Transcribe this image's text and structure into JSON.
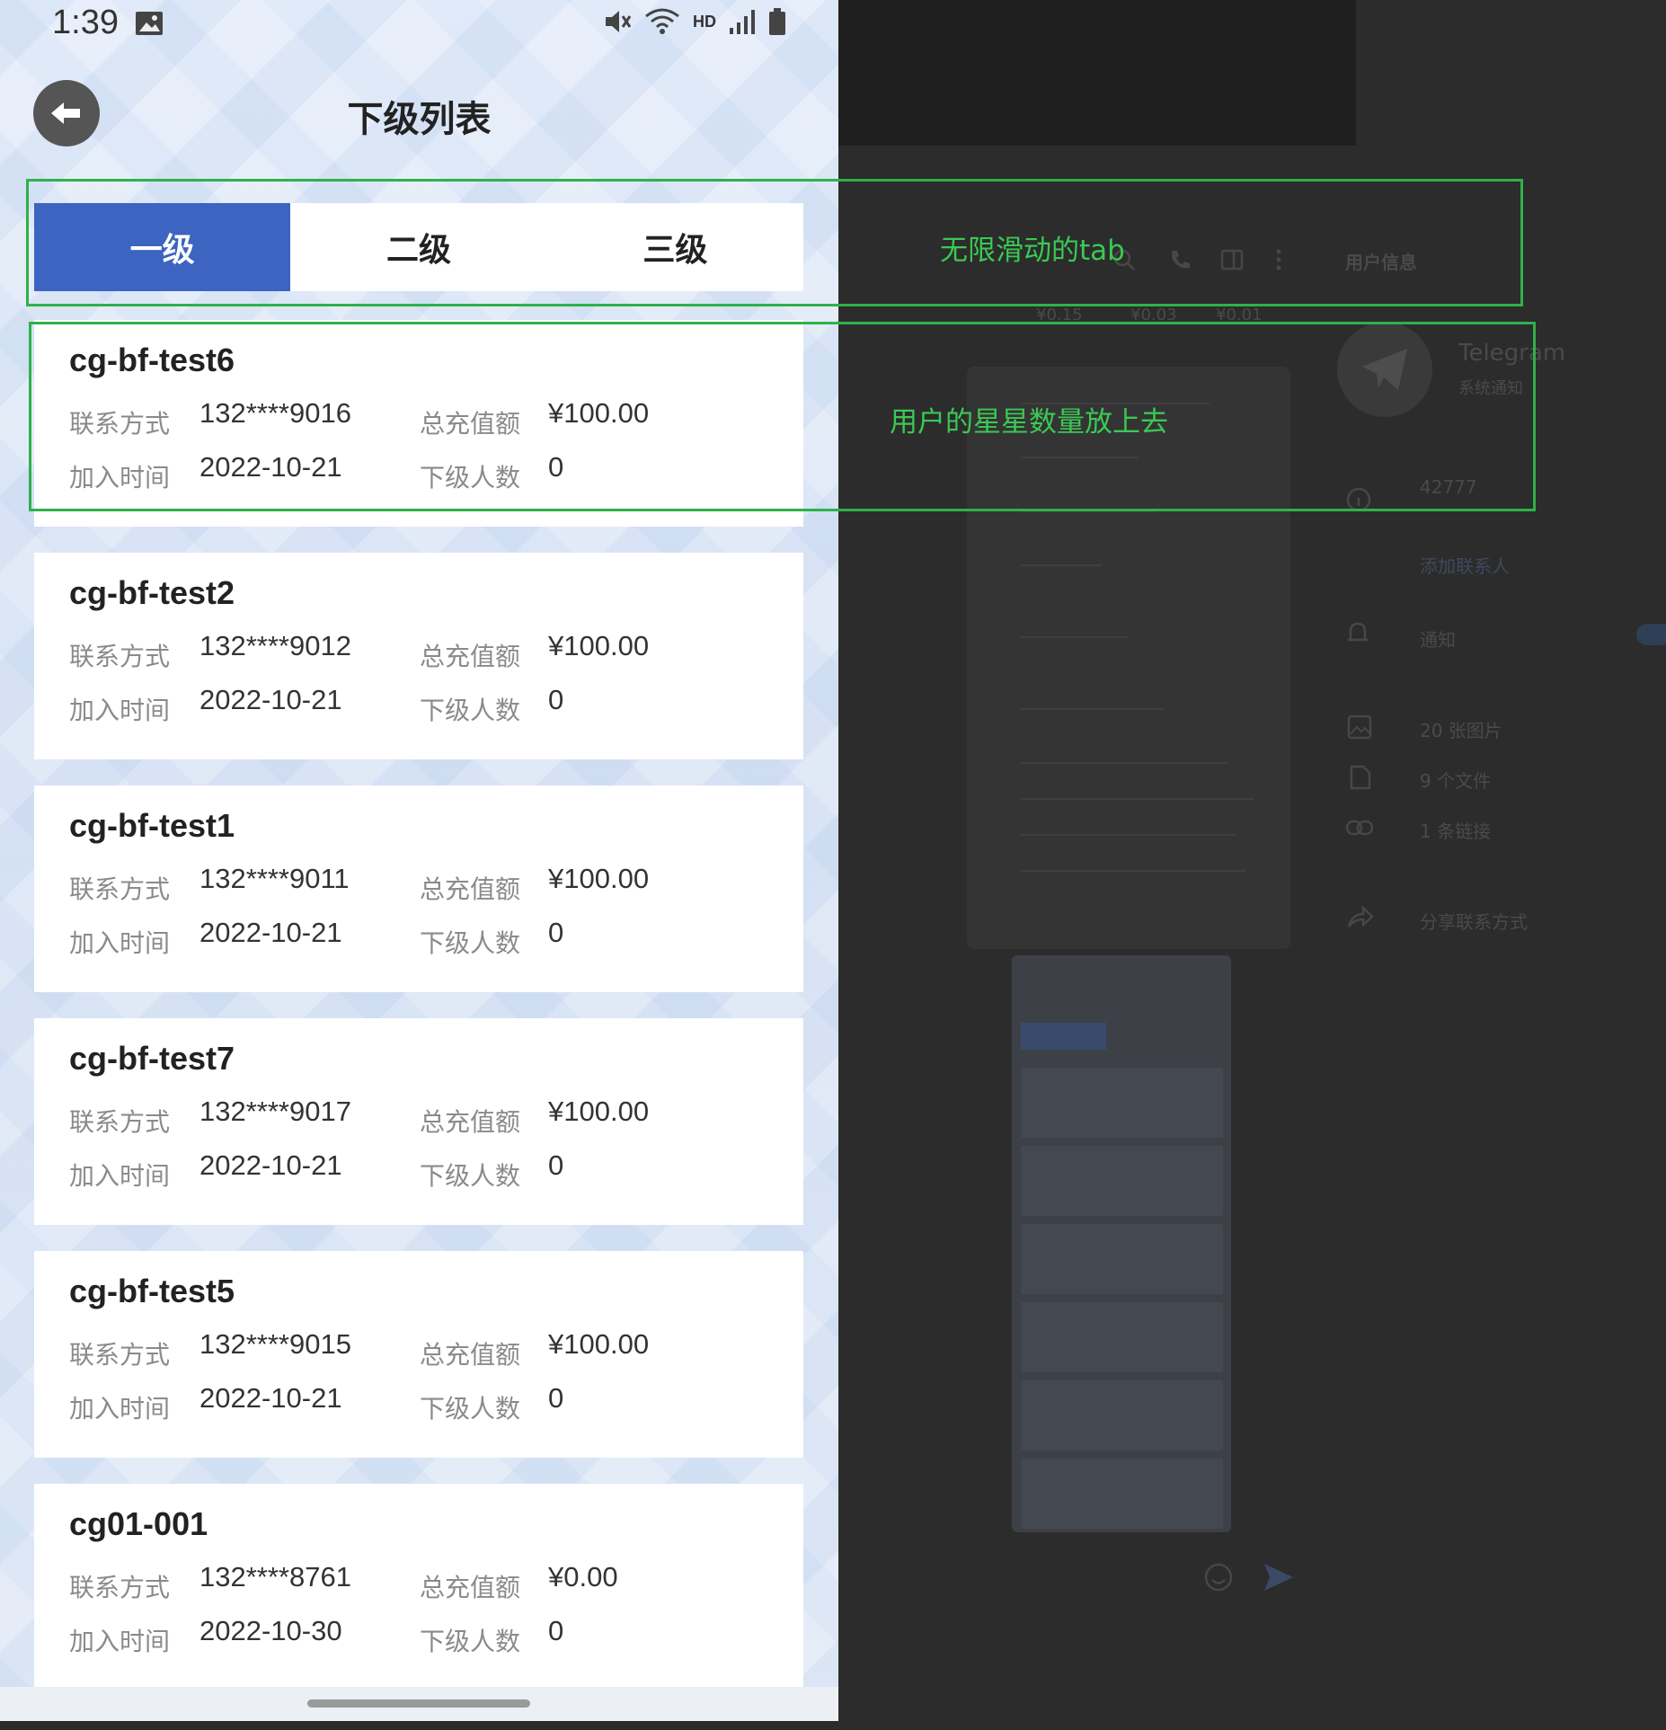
{
  "status_bar": {
    "time": "1:39",
    "network": "HD"
  },
  "header": {
    "title": "下级列表"
  },
  "tabs": [
    "一级",
    "二级",
    "三级"
  ],
  "labels": {
    "contact": "联系方式",
    "total_recharge": "总充值额",
    "join_time": "加入时间",
    "sub_count": "下级人数"
  },
  "members": [
    {
      "name": "cg-bf-test6",
      "contact": "132****9016",
      "total": "¥100.00",
      "joined": "2022-10-21",
      "subs": "0"
    },
    {
      "name": "cg-bf-test2",
      "contact": "132****9012",
      "total": "¥100.00",
      "joined": "2022-10-21",
      "subs": "0"
    },
    {
      "name": "cg-bf-test1",
      "contact": "132****9011",
      "total": "¥100.00",
      "joined": "2022-10-21",
      "subs": "0"
    },
    {
      "name": "cg-bf-test7",
      "contact": "132****9017",
      "total": "¥100.00",
      "joined": "2022-10-21",
      "subs": "0"
    },
    {
      "name": "cg-bf-test5",
      "contact": "132****9015",
      "total": "¥100.00",
      "joined": "2022-10-21",
      "subs": "0"
    },
    {
      "name": "cg01-001",
      "contact": "132****8761",
      "total": "¥0.00",
      "joined": "2022-10-30",
      "subs": "0"
    }
  ],
  "annotations": {
    "tab_note": "无限滑动的tab",
    "card_note": "用户的星星数量放上去"
  },
  "background_window": {
    "panel_title": "用户信息",
    "app_name": "Telegram",
    "subtitle": "系统通知",
    "user_id": "42777",
    "add_contact": "添加联系人",
    "notifications": "通知",
    "photos": "20 张图片",
    "files": "9 个文件",
    "links": "1 条链接",
    "share_contact": "分享联系方式",
    "mini_values": [
      "¥0.15",
      "¥0.03",
      "¥0.01"
    ]
  },
  "colors": {
    "active_tab": "#3c64c0",
    "annotation": "#2fb14a"
  }
}
